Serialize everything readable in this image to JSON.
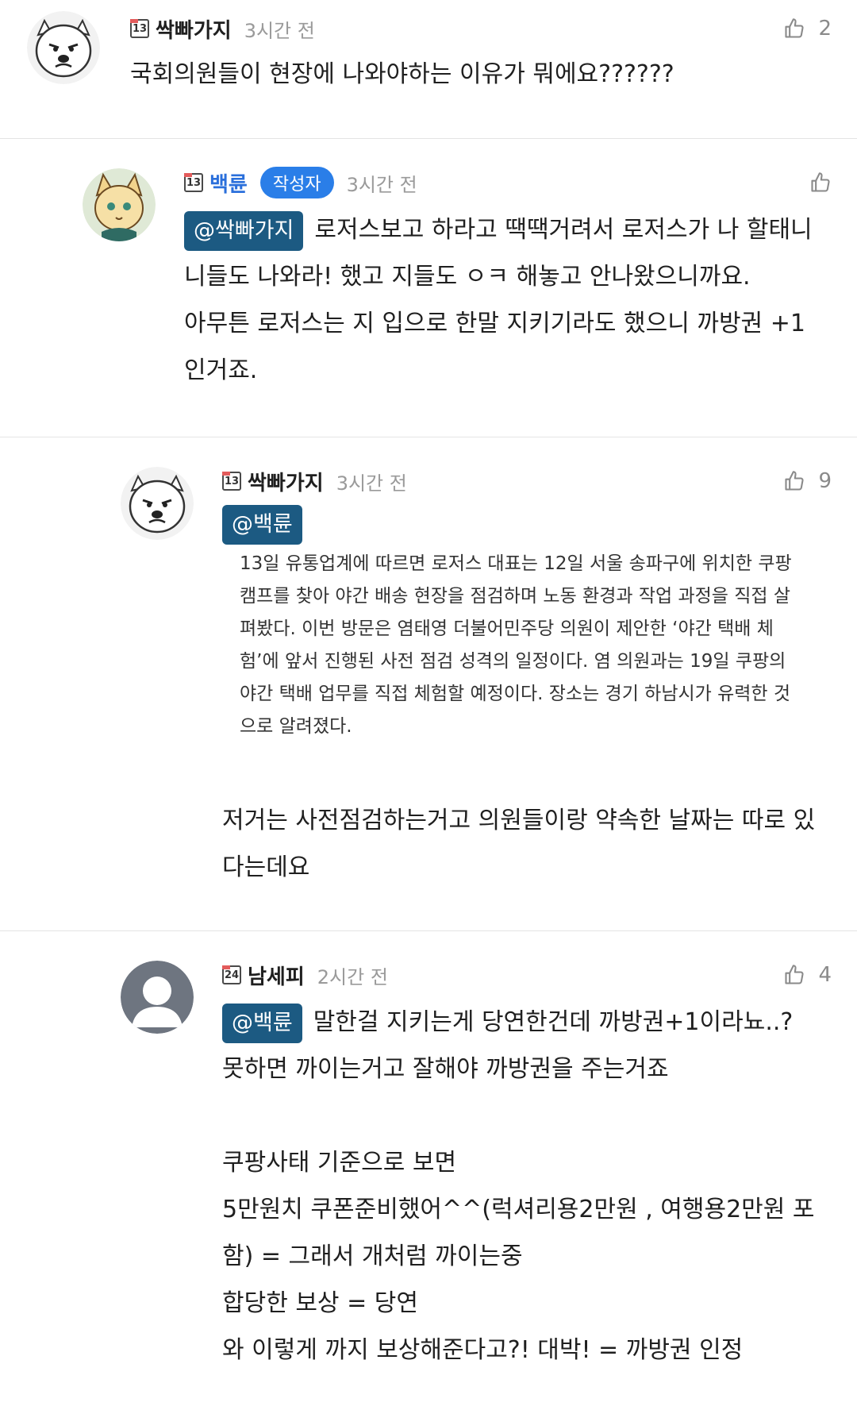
{
  "comments": [
    {
      "nickname": "싹빠가지",
      "level": "13",
      "time": "3시간 전",
      "likes": "2",
      "text": "국회의원들이 현장에 나와야하는 이유가 뭐에요??????",
      "avatar_icon": "white-bear-avatar-icon"
    },
    {
      "nickname": "백륜",
      "level": "13",
      "author_badge": "작성자",
      "time": "3시간 전",
      "mention": "@싹빠가지",
      "lines": [
        "로저스보고 하라고 땍땍거려서 로저스가 나 할태니",
        "니들도 나와라! 했고 지들도 ㅇㅋ 해놓고 안나왔으니까요.",
        "아무튼 로저스는 지 입으로 한말 지키기라도 했으니 까방권 +1",
        "인거죠."
      ],
      "avatar_icon": "fox-character-avatar-icon"
    },
    {
      "nickname": "싹빠가지",
      "level": "13",
      "time": "3시간 전",
      "likes": "9",
      "mention": "@백륜",
      "quote_lines": [
        "13일 유통업계에 따르면 로저스 대표는 12일 서울 송파구에 위치한 쿠팡",
        "캠프를 찾아 야간 배송 현장을 점검하며 노동 환경과 작업 과정을 직접 살",
        "펴봤다. 이번 방문은 염태영 더불어민주당 의원이 제안한 ‘야간 택배 체",
        "험’에 앞서 진행된 사전 점검 성격의 일정이다. 염 의원과는 19일 쿠팡의",
        "야간 택배 업무를 직접 체험할 예정이다. 장소는 경기 하남시가 유력한 것",
        "으로 알려졌다."
      ],
      "lines": [
        "저거는 사전점검하는거고 의원들이랑 약속한 날짜는 따로 있",
        "다는데요"
      ],
      "avatar_icon": "white-bear-avatar-icon"
    },
    {
      "nickname": "남세피",
      "level": "24",
      "time": "2시간 전",
      "likes": "4",
      "mention": "@백륜",
      "first_line": "말한걸 지키는게 당연한건데 까방권+1이라뇨..?",
      "lines": [
        "못하면 까이는거고 잘해야 까방권을 주는거죠",
        "",
        "쿠팡사태 기준으로 보면",
        "5만원치 쿠폰준비했어^^(럭셔리용2만원 , 여행용2만원 포",
        "함) = 그래서 개처럼 까이는중",
        "합당한 보상 = 당연",
        "와 이렇게 까지 보상해준다고?! 대박! = 까방권 인정"
      ],
      "avatar_icon": "default-user-avatar-icon"
    }
  ],
  "icons": {
    "like": "thumbs-up-icon"
  },
  "colors": {
    "mention_bg": "#1c5a82",
    "author_badge_bg": "#2a7ee8",
    "author_nick": "#2a6fdb"
  }
}
